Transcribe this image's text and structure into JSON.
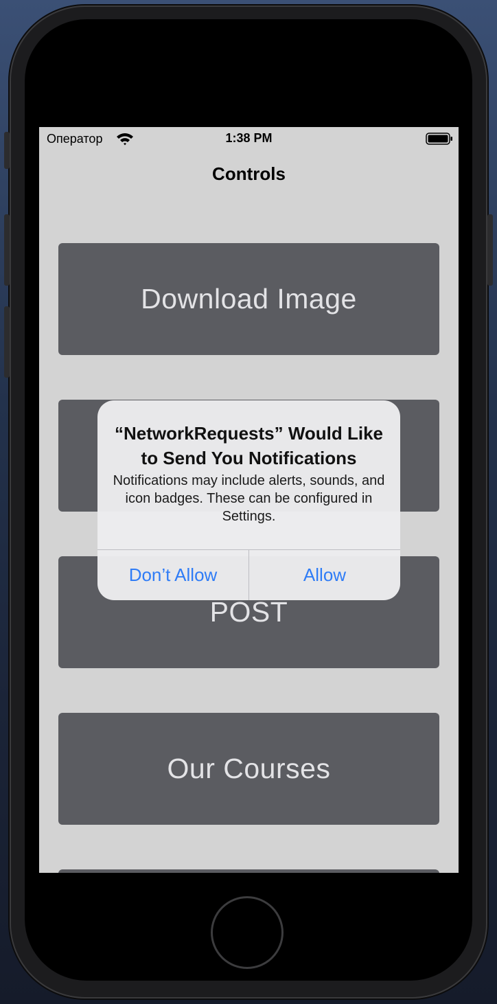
{
  "status_bar": {
    "carrier": "Оператор",
    "time": "1:38 PM",
    "wifi_icon": "wifi-icon",
    "battery_icon": "battery-full-icon"
  },
  "nav": {
    "title": "Controls"
  },
  "buttons": [
    {
      "label": "Download Image"
    },
    {
      "label": ""
    },
    {
      "label": "POST"
    },
    {
      "label": "Our Courses"
    }
  ],
  "alert": {
    "title": "“NetworkRequests” Would Like to Send You Notifications",
    "message": "Notifications may include alerts, sounds, and icon badges. These can be configured in Settings.",
    "dont_allow_label": "Don’t Allow",
    "allow_label": "Allow"
  },
  "colors": {
    "screen_background": "#d3d3d3",
    "button_background": "#5b5c61",
    "button_text": "#e3e3e6",
    "alert_action": "#2f7cf6"
  }
}
